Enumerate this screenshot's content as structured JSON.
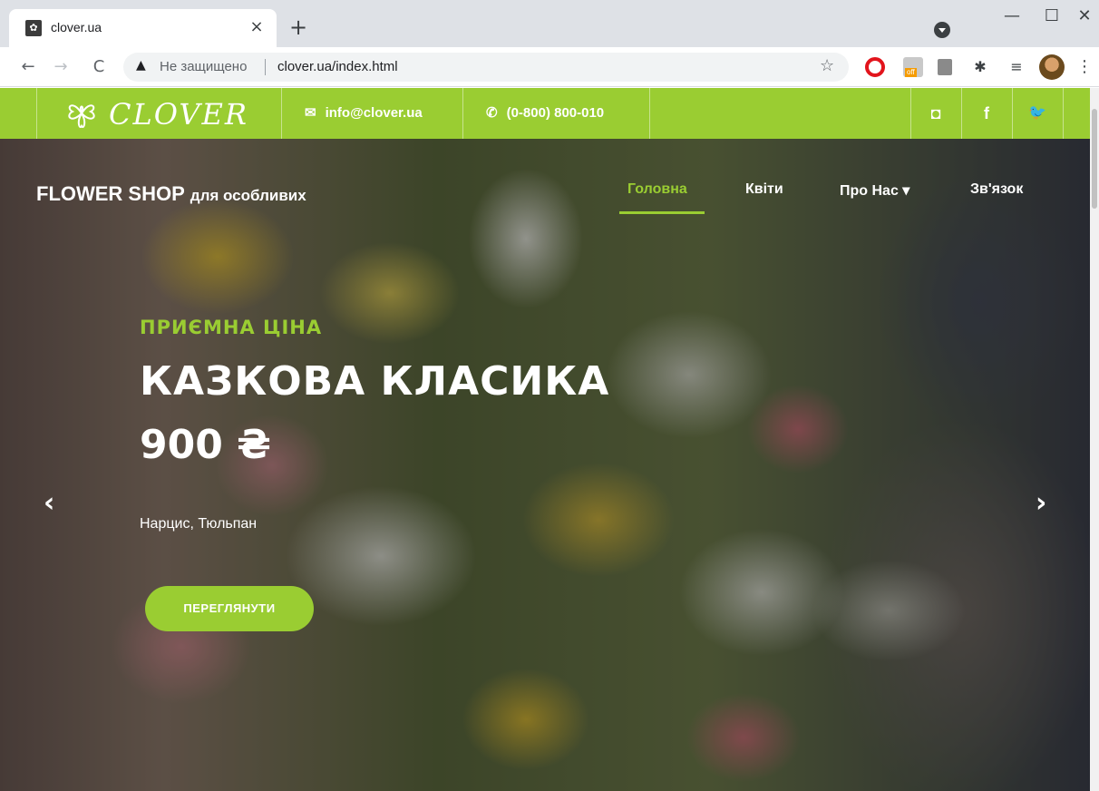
{
  "browser": {
    "tab_title": "clover.ua",
    "tab_close": "×",
    "new_tab": "+",
    "window_minimize": "—",
    "window_maximize": "☐",
    "window_close": "✕",
    "back": "←",
    "forward": "→",
    "reload": "C",
    "security_icon": "▲",
    "security_label": "Не защищено",
    "url": "clover.ua/index.html",
    "bookmark_icon": "☆",
    "extension_off_badge": "off",
    "extensions_icon": "✱",
    "menu_icon": "⋮",
    "queue_icon": "≡"
  },
  "topbar": {
    "logo_text": "CLOVER",
    "email": "info@clover.ua",
    "phone": "(0-800) 800-010",
    "email_icon": "✉",
    "phone_icon": "✆",
    "social": {
      "instagram": "◘",
      "facebook": "f",
      "twitter": "🐦"
    },
    "accent_color": "#9acd32"
  },
  "header": {
    "brand": "FLOWER SHOP",
    "brand_tagline": "для особливих",
    "nav": {
      "home": "Головна",
      "flowers": "Квіти",
      "about": "Про Нас ▾",
      "contact": "Зв'язок"
    },
    "active_item": "Головна"
  },
  "slide": {
    "eyebrow": "ПРИЄМНА ЦІНА",
    "title": "КАЗКОВА КЛАСИКА",
    "price": "900 ₴",
    "description": "Нарцис, Тюльпан",
    "button_label": "ПЕРЕГЛЯНУТИ",
    "prev_arrow": "‹",
    "next_arrow": "›"
  }
}
